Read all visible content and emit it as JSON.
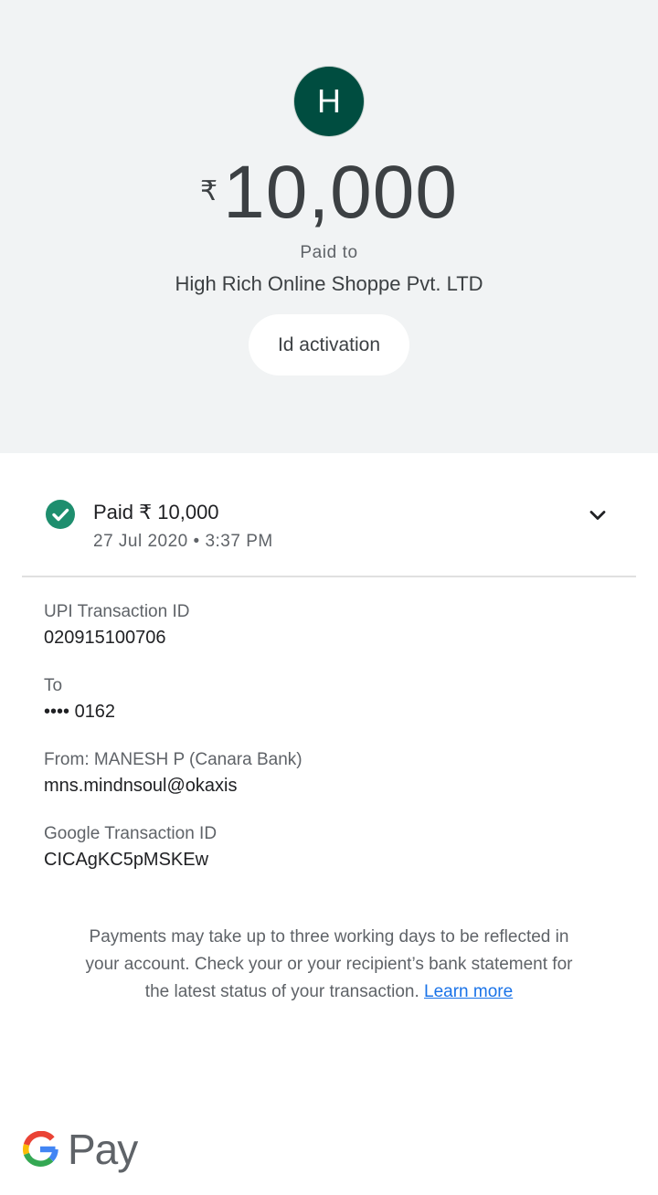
{
  "hero": {
    "avatar_letter": "H",
    "currency_symbol": "₹",
    "amount": "10,000",
    "paid_to_label": "Paid to",
    "payee_name": "High Rich Online Shoppe Pvt. LTD",
    "note": "Id activation"
  },
  "status": {
    "title": "Paid ₹ 10,000",
    "datetime": "27 Jul 2020 • 3:37 PM",
    "icon": "check-circle-icon",
    "expand_icon": "chevron-down-icon"
  },
  "details": [
    {
      "label": "UPI Transaction ID",
      "value": "020915100706"
    },
    {
      "label": "To",
      "value": "•••• 0162"
    },
    {
      "label": "From: MANESH P (Canara Bank)",
      "value": "mns.mindnsoul@okaxis"
    },
    {
      "label": "Google Transaction ID",
      "value": "CICAgKC5pMSKEw"
    }
  ],
  "disclaimer": {
    "text": "Payments may take up to three working days to be reflected in your account. Check your or your recipient’s bank statement for the latest status of your transaction. ",
    "link": "Learn more"
  },
  "brand": {
    "logo_icon": "google-g-icon",
    "pay_text": "Pay"
  },
  "colors": {
    "avatar_bg": "#004d40",
    "success": "#1e8e6e",
    "link": "#1a73e8",
    "hero_bg": "#f1f3f4"
  }
}
